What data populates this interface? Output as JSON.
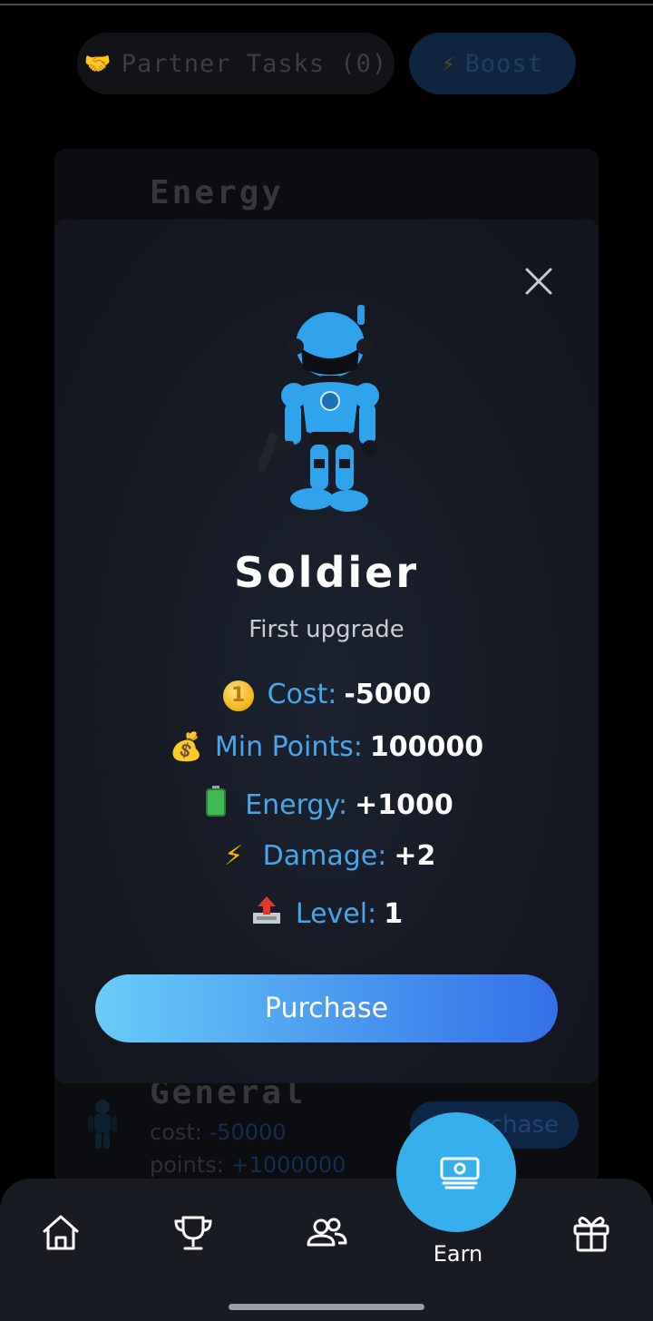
{
  "background": {
    "tabs": [
      {
        "icon": "handshake-icon",
        "label": "Partner Tasks (0)"
      },
      {
        "icon": "lightning-icon",
        "label": "Boost"
      }
    ],
    "section_energy": "Energy",
    "general_item": {
      "title": "General",
      "cost_label": "cost: ",
      "cost_value": "-50000",
      "points_label": "points: ",
      "points_value": "+1000000",
      "button_label": "Purchase"
    }
  },
  "modal": {
    "title": "Soldier",
    "subtitle": "First upgrade",
    "stats": [
      {
        "icon": "coin-icon",
        "label": "Cost:",
        "value": "-5000"
      },
      {
        "icon": "money-bag-icon",
        "label": "Min Points:",
        "value": "100000"
      },
      {
        "icon": "battery-icon",
        "label": "Energy:",
        "value": "+1000"
      },
      {
        "icon": "lightning-icon",
        "label": "Damage:",
        "value": "+2"
      },
      {
        "icon": "level-up-icon",
        "label": "Level:",
        "value": "1"
      }
    ],
    "purchase_label": "Purchase"
  },
  "nav": {
    "items": [
      "home-icon",
      "trophy-icon",
      "friends-icon",
      "earn-icon",
      "gift-icon"
    ],
    "active_label": "Earn"
  },
  "colors": {
    "accent": "#36b0ec",
    "label_blue": "#49a6ea",
    "button_gradient_start": "#69ccf6",
    "button_gradient_end": "#3470ea"
  }
}
